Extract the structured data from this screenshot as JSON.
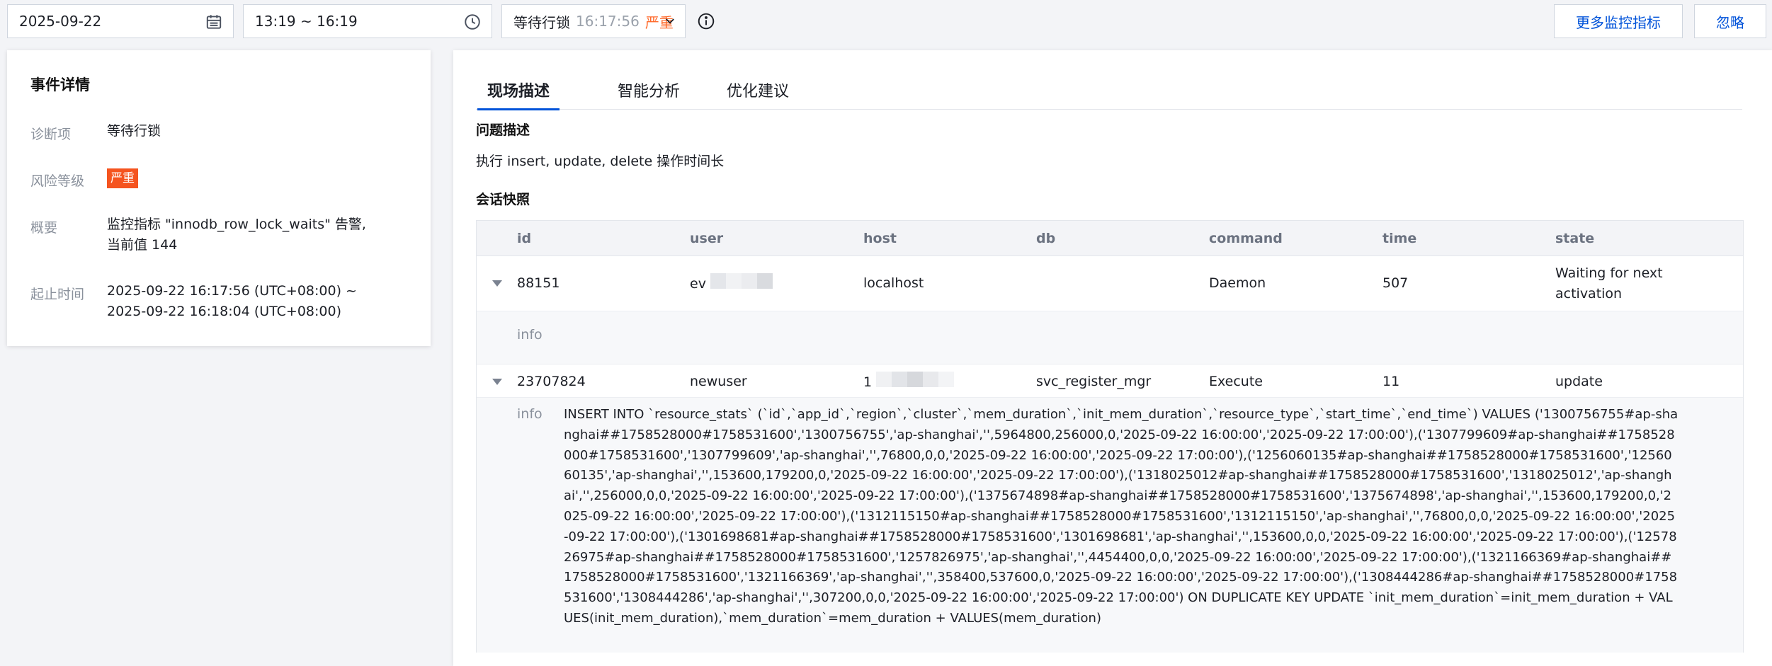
{
  "toolbar": {
    "date": "2025-09-22",
    "time_range": "13:19 ~ 16:19",
    "event_select": {
      "name": "等待行锁",
      "time": "16:17:56",
      "severity": "严重"
    },
    "more_metrics_button": "更多监控指标",
    "ignore_button": "忽略"
  },
  "event_details": {
    "title": "事件详情",
    "diagnosis_label": "诊断项",
    "diagnosis_value": "等待行锁",
    "risk_label": "风险等级",
    "risk_value": "严重",
    "summary_label": "概要",
    "summary_line1": "监控指标 \"innodb_row_lock_waits\" 告警,",
    "summary_line2": "当前值 144",
    "period_label": "起止时间",
    "period_line1": "2025-09-22 16:17:56 (UTC+08:00) ~",
    "period_line2": "2025-09-22 16:18:04 (UTC+08:00)"
  },
  "tabs": [
    "现场描述",
    "智能分析",
    "优化建议"
  ],
  "problem": {
    "title": "问题描述",
    "text": "执行 insert, update, delete 操作时间长"
  },
  "snapshot": {
    "title": "会话快照",
    "columns": [
      "id",
      "user",
      "host",
      "db",
      "command",
      "time",
      "state"
    ],
    "info_label": "info",
    "rows": [
      {
        "id": "88151",
        "user": "ev",
        "host": "localhost",
        "db": "",
        "command": "Daemon",
        "time": "507",
        "state_line1": "Waiting for next",
        "state_line2": "activation",
        "info": ""
      },
      {
        "id": "23707824",
        "user": "newuser",
        "host": "1",
        "db": "svc_register_mgr",
        "command": "Execute",
        "time": "11",
        "state_line1": "update",
        "state_line2": "",
        "info": "INSERT INTO `resource_stats` (`id`,`app_id`,`region`,`cluster`,`mem_duration`,`init_mem_duration`,`resource_type`,`start_time`,`end_time`) VALUES ('1300756755#ap-shanghai##1758528000#1758531600','1300756755','ap-shanghai','',5964800,256000,0,'2025-09-22 16:00:00','2025-09-22 17:00:00'),('1307799609#ap-shanghai##1758528000#1758531600','1307799609','ap-shanghai','',76800,0,0,'2025-09-22 16:00:00','2025-09-22 17:00:00'),('1256060135#ap-shanghai##1758528000#1758531600','1256060135','ap-shanghai','',153600,179200,0,'2025-09-22 16:00:00','2025-09-22 17:00:00'),('1318025012#ap-shanghai##1758528000#1758531600','1318025012','ap-shanghai','',256000,0,0,'2025-09-22 16:00:00','2025-09-22 17:00:00'),('1375674898#ap-shanghai##1758528000#1758531600','1375674898','ap-shanghai','',153600,179200,0,'2025-09-22 16:00:00','2025-09-22 17:00:00'),('1312115150#ap-shanghai##1758528000#1758531600','1312115150','ap-shanghai','',76800,0,0,'2025-09-22 16:00:00','2025-09-22 17:00:00'),('1301698681#ap-shanghai##1758528000#1758531600','1301698681','ap-shanghai','',153600,0,0,'2025-09-22 16:00:00','2025-09-22 17:00:00'),('1257826975#ap-shanghai##1758528000#1758531600','1257826975','ap-shanghai','',4454400,0,0,'2025-09-22 16:00:00','2025-09-22 17:00:00'),('1321166369#ap-shanghai##1758528000#1758531600','1321166369','ap-shanghai','',358400,537600,0,'2025-09-22 16:00:00','2025-09-22 17:00:00'),('1308444286#ap-shanghai##1758528000#1758531600','1308444286','ap-shanghai','',307200,0,0,'2025-09-22 16:00:00','2025-09-22 17:00:00') ON DUPLICATE KEY UPDATE `init_mem_duration`=init_mem_duration + VALUES(init_mem_duration),`mem_duration`=mem_duration + VALUES(mem_duration)"
      }
    ]
  },
  "colors": {
    "accent": "#0052d9",
    "severity": "#f5541f",
    "severity_text": "#ff6a2b"
  },
  "icons": {
    "date": "calendar-icon",
    "time": "clock-icon",
    "dropdown": "chevron-down-icon",
    "help": "info-circle-icon",
    "row_toggle": "caret-down-icon"
  }
}
